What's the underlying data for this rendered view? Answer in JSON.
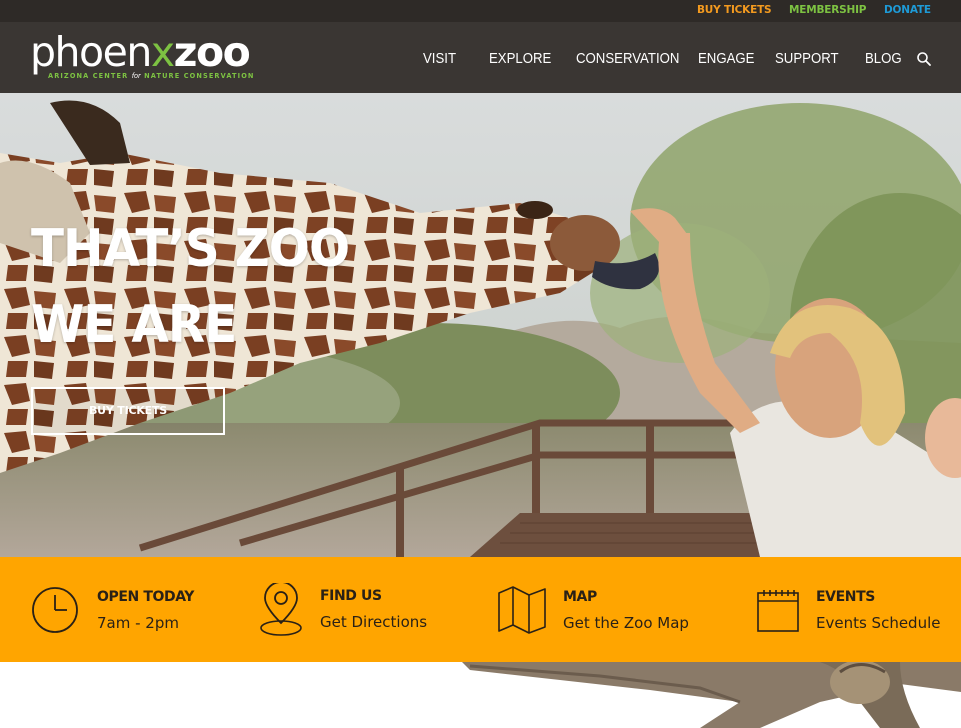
{
  "utility": {
    "buy_tickets": "BUY TICKETS",
    "membership": "MEMBERSHIP",
    "donate": "DONATE"
  },
  "logo": {
    "word_phoen": "phoen",
    "word_x": "x",
    "word_zoo": "zoo",
    "tagline_left": "ARIZONA CENTER",
    "tagline_mid": "for",
    "tagline_right": "NATURE CONSERVATION"
  },
  "nav": {
    "items": [
      "VISIT",
      "EXPLORE",
      "CONSERVATION",
      "ENGAGE",
      "SUPPORT",
      "BLOG"
    ],
    "search_icon": "search-icon"
  },
  "hero": {
    "title_line1": "THAT’S ZOO",
    "title_line2": "WE ARE",
    "cta_label": "BUY TICKETS"
  },
  "info": [
    {
      "icon": "clock-icon",
      "heading": "OPEN TODAY",
      "sub": "7am - 2pm"
    },
    {
      "icon": "map-pin-icon",
      "heading": "FIND US",
      "sub": "Get Directions"
    },
    {
      "icon": "folded-map-icon",
      "heading": "MAP",
      "sub": "Get the Zoo Map"
    },
    {
      "icon": "calendar-icon",
      "heading": "EVENTS",
      "sub": "Events Schedule"
    }
  ],
  "colors": {
    "topbar": "#2e2a27",
    "header": "#3a3633",
    "accent_orange": "#ffa500",
    "buy_tickets": "#f39a1f",
    "membership": "#7dc242",
    "donate": "#1e9ad6"
  }
}
